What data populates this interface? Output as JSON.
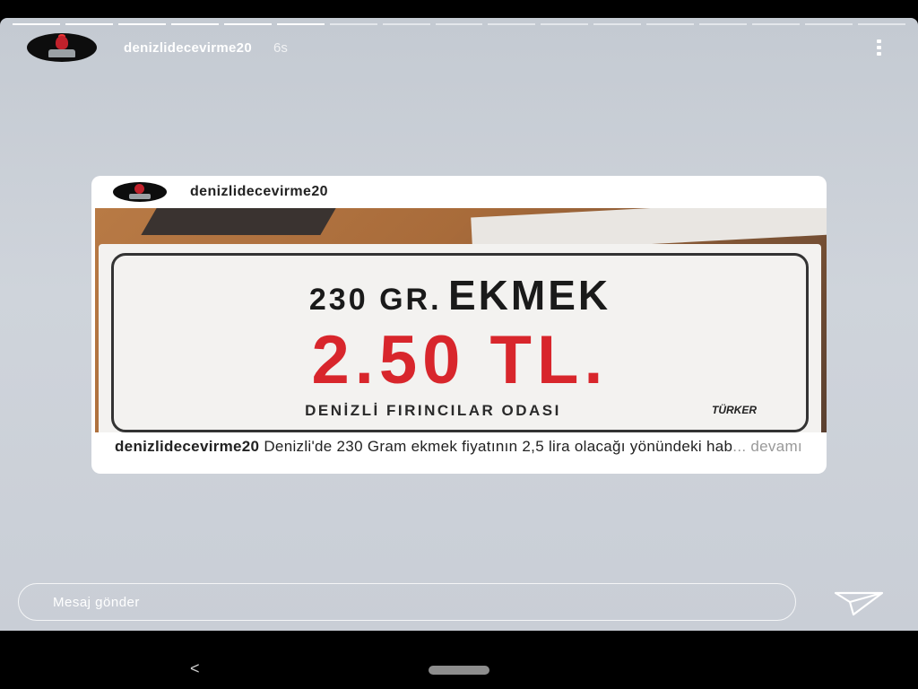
{
  "story": {
    "username": "denizlidecevirme20",
    "time": "6s",
    "progress_total": 17,
    "progress_done": 6
  },
  "post": {
    "username": "denizlidecevirme20",
    "sign": {
      "line1_a": "230 GR.",
      "line1_b": "EKMEK",
      "price": "2.50 TL.",
      "org": "DENİZLİ FIRINCILAR ODASI",
      "brand": "TÜRKER"
    },
    "caption_user": "denizlidecevirme20",
    "caption_text": "Denizli'de 230 Gram ekmek fiyatının 2,5 lira olacağı yönündeki hab",
    "more_label": "... devamı"
  },
  "reply": {
    "placeholder": "Mesaj gönder"
  },
  "icons": {
    "more": "more-vertical-icon",
    "send": "paper-plane-icon",
    "back": "back-chevron-icon",
    "home": "home-pill-icon"
  },
  "nav": {
    "back_glyph": "<"
  },
  "colors": {
    "price_red": "#d8262c",
    "background": "#c9ced6"
  }
}
